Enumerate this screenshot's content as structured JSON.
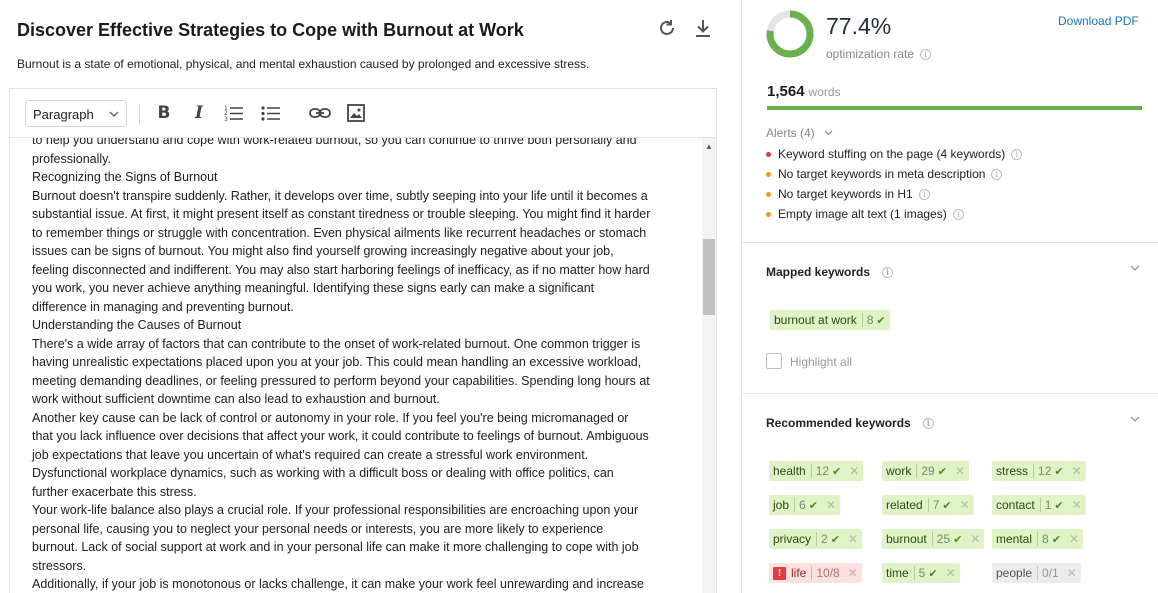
{
  "article": {
    "title": "Discover Effective Strategies to Cope with Burnout at Work",
    "meta_description": "Burnout is a state of emotional, physical, and mental exhaustion caused by prolonged and excessive stress."
  },
  "toolbar": {
    "block_format": "Paragraph",
    "icons": [
      "bold-icon",
      "italic-icon",
      "ordered-list-icon",
      "bullet-list-icon",
      "link-icon",
      "image-icon"
    ]
  },
  "header_icons": [
    "refresh-icon",
    "download-icon"
  ],
  "content": {
    "lines": [
      "to help you understand and cope with work-related burnout, so you can continue to thrive both personally and",
      "professionally.",
      "Recognizing the Signs of Burnout",
      "Burnout doesn't transpire suddenly. Rather, it develops over time, subtly seeping into your life until it becomes a",
      "substantial issue. At first, it might present itself as constant tiredness or trouble sleeping. You might find it harder",
      "to remember things or struggle with concentration. Even physical ailments like recurrent headaches or stomach",
      "issues can be signs of burnout. You might also find yourself growing increasingly negative about your job,",
      "feeling disconnected and indifferent. You may also start harboring feelings of inefficacy, as if no matter how hard",
      "you work, you never achieve anything meaningful. Identifying these signs early can make a significant",
      "difference in managing and preventing burnout.",
      "Understanding the Causes of Burnout",
      "There's a wide array of factors that can contribute to the onset of work-related burnout. One common trigger is",
      "having unrealistic expectations placed upon you at your job. This could mean handling an excessive workload,",
      "meeting demanding deadlines, or feeling pressured to perform beyond your capabilities. Spending long hours at",
      "work without sufficient downtime can also lead to exhaustion and burnout.",
      "Another key cause can be lack of control or autonomy in your role. If you feel you're being micromanaged or",
      "that you lack influence over decisions that affect your work, it could contribute to feelings of burnout. Ambiguous",
      "job expectations that leave you uncertain of what's required can create a stressful work environment.",
      "Dysfunctional workplace dynamics, such as working with a difficult boss or dealing with office politics, can",
      "further exacerbate this stress.",
      "Your work-life balance also plays a crucial role. If your professional responsibilities are encroaching upon your",
      "personal life, causing you to neglect your personal needs or interests, you are more likely to experience",
      "burnout. Lack of social support at work and in your personal life can make it more challenging to cope with job",
      "stressors.",
      "Additionally, if your job is monotonous or lacks challenge, it can make your work feel unrewarding and increase"
    ]
  },
  "score": {
    "value": "77.4%",
    "fraction": 0.774,
    "label": "optimization rate",
    "download_label": "Download PDF",
    "accent_color": "#6ab04c"
  },
  "words": {
    "count": "1,564",
    "label": "words"
  },
  "alerts": {
    "label": "Alerts (4)",
    "items": [
      {
        "text": "Keyword stuffing on the page (4 keywords)",
        "color": "#e53935"
      },
      {
        "text": "No target keywords in meta description",
        "color": "#f39c12"
      },
      {
        "text": "No target keywords in H1",
        "color": "#f39c12"
      },
      {
        "text": "Empty image alt text (1 images)",
        "color": "#f39c12"
      }
    ]
  },
  "mapped": {
    "heading": "Mapped keywords",
    "keywords": [
      {
        "kw": "burnout at work",
        "count": "8"
      }
    ],
    "highlight_label": "Highlight all"
  },
  "recommended": {
    "heading": "Recommended keywords",
    "keywords": [
      {
        "kw": "health",
        "count": "12",
        "state": "ok"
      },
      {
        "kw": "work",
        "count": "29",
        "state": "ok"
      },
      {
        "kw": "stress",
        "count": "12",
        "state": "ok"
      },
      {
        "kw": "job",
        "count": "6",
        "state": "ok"
      },
      {
        "kw": "related",
        "count": "7",
        "state": "ok"
      },
      {
        "kw": "contact",
        "count": "1",
        "state": "ok"
      },
      {
        "kw": "privacy",
        "count": "2",
        "state": "ok"
      },
      {
        "kw": "burnout",
        "count": "25",
        "state": "ok"
      },
      {
        "kw": "mental",
        "count": "8",
        "state": "ok"
      },
      {
        "kw": "life",
        "count": "10/8",
        "state": "over"
      },
      {
        "kw": "time",
        "count": "5",
        "state": "ok"
      },
      {
        "kw": "people",
        "count": "0/1",
        "state": "missing"
      }
    ]
  }
}
